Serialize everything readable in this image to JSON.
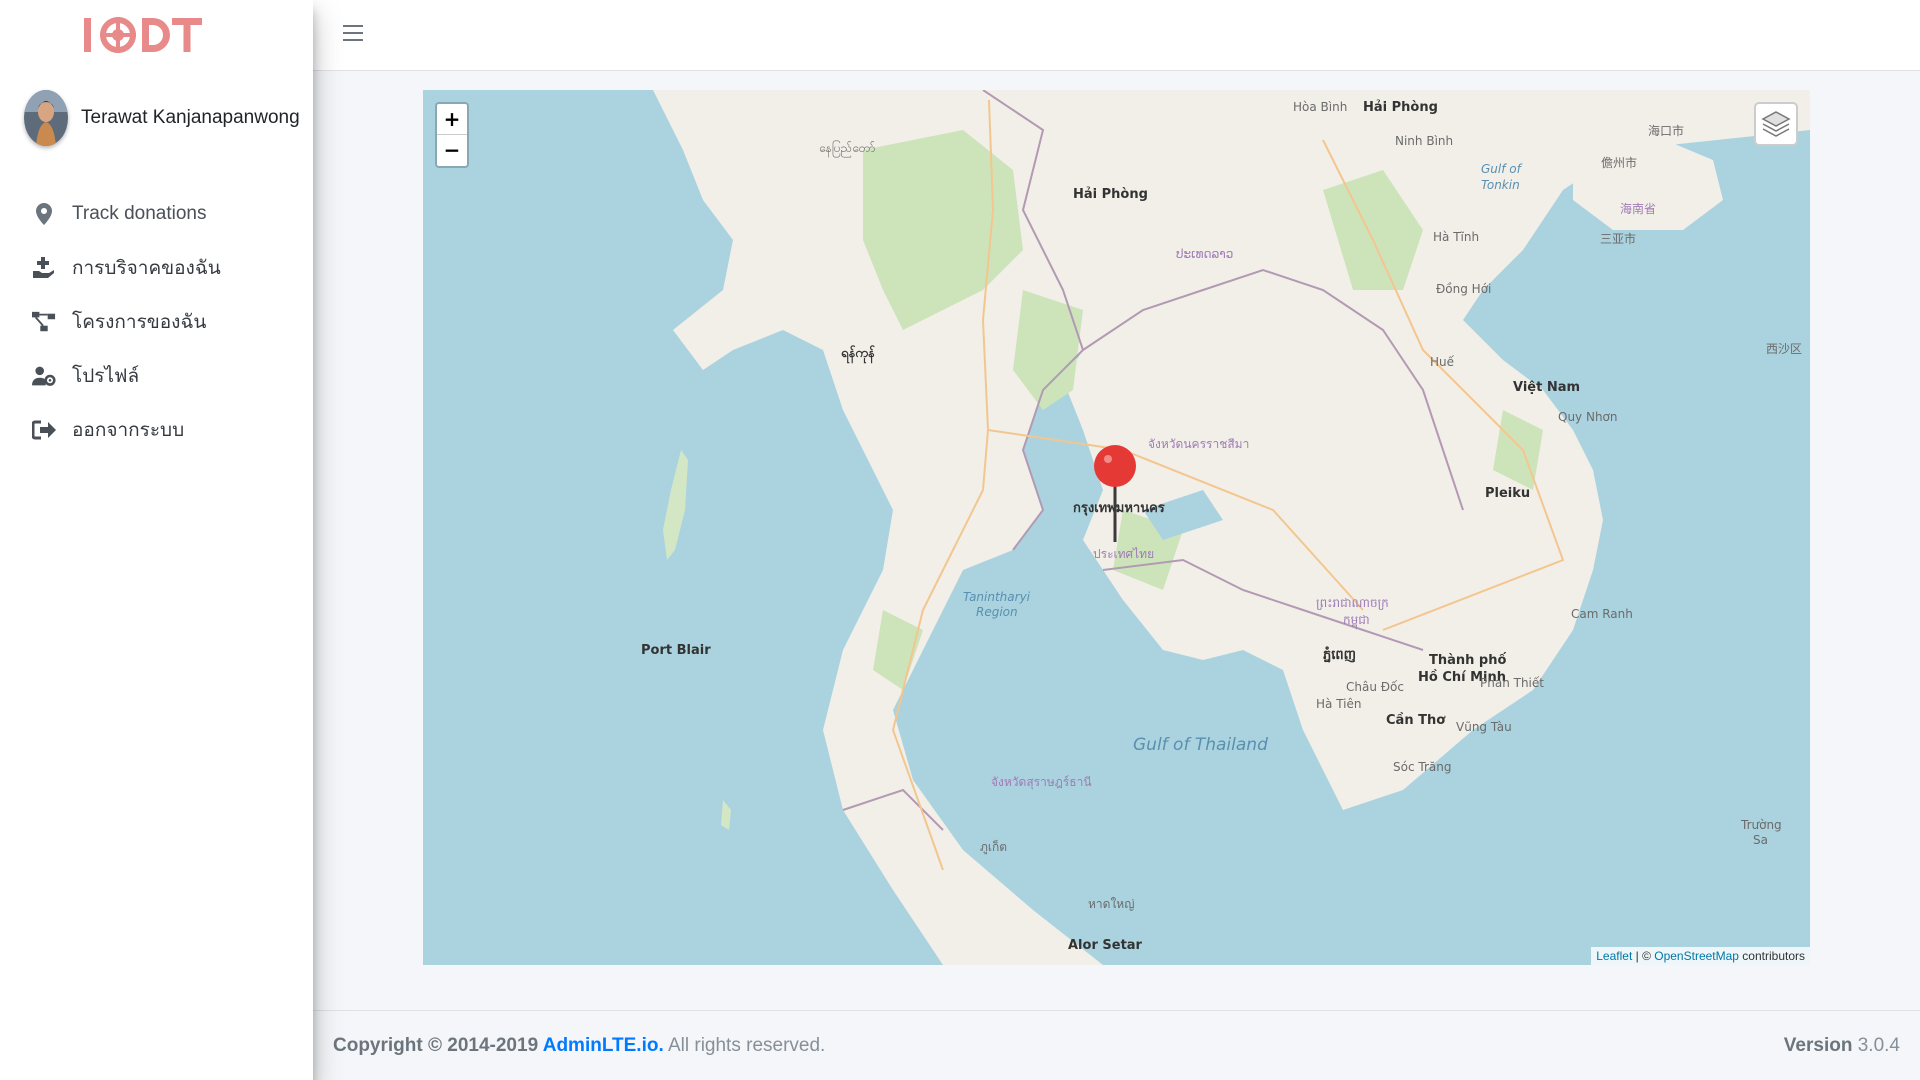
{
  "brand": {
    "logo_text": "I DT",
    "logo_color": "#e88a8a"
  },
  "user": {
    "name": "Terawat Kanjanapanwong"
  },
  "nav": {
    "items": [
      {
        "label": "Track donations",
        "icon": "map-marker-icon"
      },
      {
        "label": "การบริจาคของฉัน",
        "icon": "hand-holding-heart-icon"
      },
      {
        "label": "โครงการของฉัน",
        "icon": "project-diagram-icon"
      },
      {
        "label": "โปรไฟล์",
        "icon": "user-cog-icon"
      },
      {
        "label": "ออกจากระบบ",
        "icon": "sign-out-icon"
      }
    ]
  },
  "map": {
    "zoom_in": "+",
    "zoom_out": "−",
    "attribution": {
      "leaflet": "Leaflet",
      "sep": " | © ",
      "osm": "OpenStreetMap",
      "suffix": " contributors"
    },
    "marker_color": "#e53935",
    "labels": {
      "bangkok": "กรุงเทพมหานคร",
      "thailand": "ประเทศไทย",
      "gulf": "Gulf of Thailand",
      "vietnam": "Việt Nam",
      "haiphong": "Hải Phòng",
      "hoabinh": "Hòa Bình",
      "ninhbinh": "Ninh Bình",
      "gulftonkin1": "Gulf of",
      "gulftonkin2": "Tonkin",
      "haikou": "海口市",
      "danzhou": "儋州市",
      "sanya": "三亚市",
      "hainan": "海南省",
      "xisha": "西沙区",
      "portblair": "Port Blair",
      "hochiminh1": "Thành phố",
      "hochiminh2": "Hồ Chí Minh",
      "cantho": "Cần Thơ",
      "vungtau": "Vũng Tàu",
      "pleiku": "Pleiku",
      "quynhon": "Quy Nhơn",
      "camranh": "Cam Ranh",
      "hue": "Huế",
      "donghoi": "Đồng Hới",
      "hatinh": "Hà Tĩnh",
      "alorsetar": "Alor Setar",
      "phnompenh": "ភ្នំពេញ",
      "cambodia": "ព្រះរាជាណាចក្រ",
      "cambodia2": "កម្ពុជា",
      "laos": "ປະເທດລາວ",
      "tanintharyi1": "Tanintharyi",
      "tanintharyi2": "Region",
      "truongsa1": "Trường",
      "truongsa2": "Sa",
      "naypyidaw": "နေပြည်တော်",
      "yangon": "ရန်ကုန်",
      "nakhonratchasima": "จังหวัดนครราชสีมา",
      "suratthani": "จังหวัดสุราษฎร์ธานี",
      "phuket": "ภูเก็ต",
      "hatyai": "หาดใหญ่",
      "phanthiet": "Phan Thiết",
      "socTrang": "Sóc Trăng",
      "chaudoc": "Châu Đốc",
      "hatien": "Hà Tiên"
    }
  },
  "footer": {
    "copyright_prefix": "Copyright © 2014-2019 ",
    "link": "AdminLTE.io.",
    "suffix": " All rights reserved.",
    "version_label": "Version",
    "version_value": " 3.0.4"
  }
}
